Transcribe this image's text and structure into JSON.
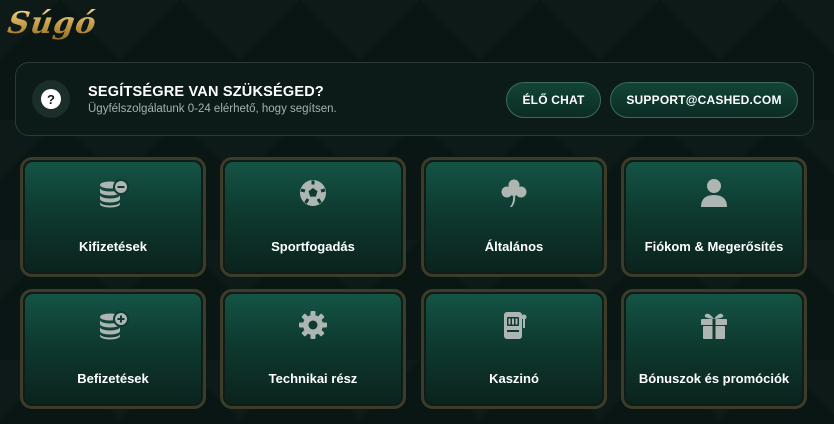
{
  "brand": {
    "logo_text": "Súgó"
  },
  "help_bar": {
    "icon": "question-icon",
    "title": "SEGÍTSÉGRE VAN SZÜKSÉGED?",
    "subtitle": "Ügyfélszolgálatunk 0-24 elérhető, hogy segítsen.",
    "chat_label": "ÉLŐ CHAT",
    "email_label": "SUPPORT@CASHED.COM"
  },
  "categories": [
    {
      "label": "Kifizetések",
      "icon": "coins-minus-icon"
    },
    {
      "label": "Sportfogadás",
      "icon": "soccer-ball-icon"
    },
    {
      "label": "Általános",
      "icon": "clover-icon"
    },
    {
      "label": "Fiókom & Megerősítés",
      "icon": "user-icon"
    },
    {
      "label": "Befizetések",
      "icon": "coins-plus-icon"
    },
    {
      "label": "Technikai rész",
      "icon": "gear-icon"
    },
    {
      "label": "Kaszinó",
      "icon": "slot-machine-icon"
    },
    {
      "label": "Bónuszok és promóciók",
      "icon": "gift-icon"
    }
  ],
  "colors": {
    "background": "#0a1614",
    "card_gradient_top": "#145445",
    "card_border": "#3b3c29",
    "icon": "#aeb6b3",
    "logo_gold": "#d6ad5a"
  }
}
